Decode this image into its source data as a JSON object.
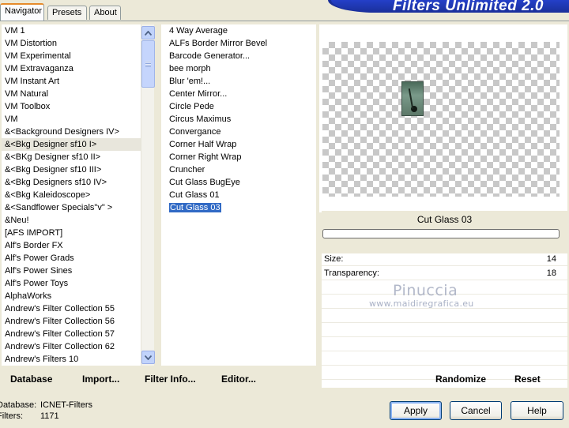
{
  "tabs": [
    {
      "label": "Navigator",
      "active": true
    },
    {
      "label": "Presets",
      "active": false
    },
    {
      "label": "About",
      "active": false
    }
  ],
  "banner_title": "Filters Unlimited 2.0",
  "categories": [
    "VM 1",
    "VM Distortion",
    "VM Experimental",
    "VM Extravaganza",
    "VM Instant Art",
    "VM Natural",
    "VM Toolbox",
    "VM",
    "&<Background Designers IV>",
    "&<Bkg Designer sf10 I>",
    "&<BKg Designer sf10 II>",
    "&<Bkg Designer sf10 III>",
    "&<Bkg Designers sf10 IV>",
    "&<Bkg Kaleidoscope>",
    "&<Sandflower Specials\"v\" >",
    "&Neu!",
    "[AFS IMPORT]",
    "Alf's Border FX",
    "Alf's Power Grads",
    "Alf's Power Sines",
    "Alf's Power Toys",
    "AlphaWorks",
    "Andrew's Filter Collection 55",
    "Andrew's Filter Collection 56",
    "Andrew's Filter Collection 57",
    "Andrew's Filter Collection 62",
    "Andrew's Filters 10"
  ],
  "highlighted_category": "&<Bkg Designer sf10 I>",
  "filters": [
    "4 Way Average",
    "ALFs Border Mirror Bevel",
    "Barcode Generator...",
    "bee morph",
    "Blur 'em!...",
    "Center Mirror...",
    "Circle Pede",
    "Circus Maximus",
    "Convergance",
    "Corner Half Wrap",
    "Corner Right Wrap",
    "Cruncher",
    "Cut Glass  BugEye",
    "Cut Glass 01",
    "Cut Glass 03"
  ],
  "selected_filter": "Cut Glass 03",
  "preview_filter_name": "Cut Glass 03",
  "params": [
    {
      "name": "Size:",
      "value": "14"
    },
    {
      "name": "Transparency:",
      "value": "18"
    }
  ],
  "watermark": {
    "line1": "Pinuccia",
    "line2": "www.maidiregrafica.eu"
  },
  "actions": {
    "database": "Database",
    "import": "Import...",
    "filter_info": "Filter Info...",
    "editor": "Editor...",
    "randomize": "Randomize",
    "reset": "Reset"
  },
  "footer": {
    "database_label": "Database:",
    "database_value": "ICNET-Filters",
    "filters_label": "Filters:",
    "filters_value": "1171"
  },
  "buttons": {
    "apply": "Apply",
    "cancel": "Cancel",
    "help": "Help"
  }
}
